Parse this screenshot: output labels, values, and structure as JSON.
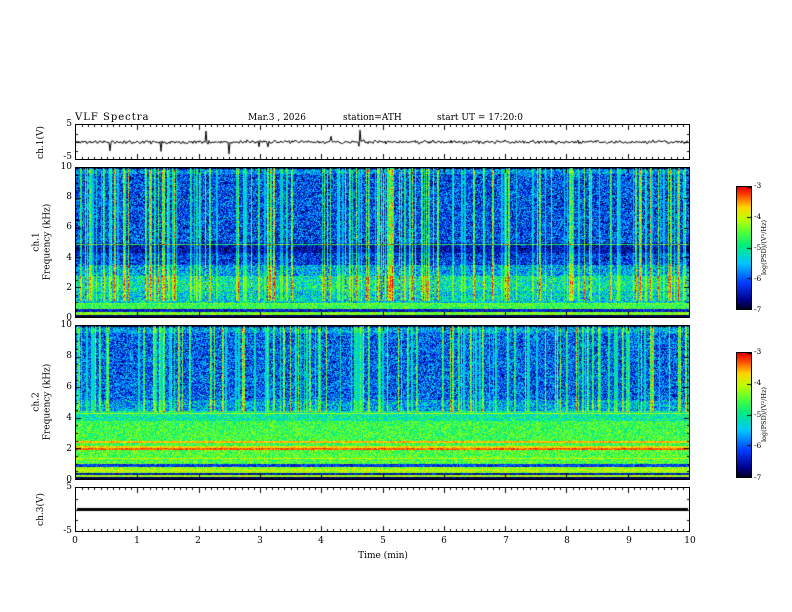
{
  "header": {
    "title": "VLF Spectra",
    "date": "Mar.3 , 2026",
    "station": "station=ATH",
    "start_ut": "start UT =  17:20:0"
  },
  "axes": {
    "time_label": "Time (min)",
    "time_ticks": [
      "0",
      "1",
      "2",
      "3",
      "4",
      "5",
      "6",
      "7",
      "8",
      "9",
      "10"
    ],
    "volt_max": "5",
    "volt_min": "-5",
    "freq_ticks": [
      "10",
      "8",
      "6",
      "4",
      "2",
      "0"
    ],
    "ch1_wave_label": "ch.1(V)",
    "ch1_spec_channel": "ch.1",
    "ch2_spec_channel": "ch.2",
    "freq_axis_label": "Frequency (kHz)",
    "ch3_wave_label": "ch.3(V)"
  },
  "colorbar": {
    "label": "log(PSD)/(V²/Hz)",
    "ticks": [
      "-3",
      "-4",
      "-5",
      "-6",
      "-7"
    ]
  },
  "chart_data": [
    {
      "type": "line",
      "name": "ch.1 waveform",
      "ylabel": "ch.1(V)",
      "xlabel": "Time (min)",
      "xlim": [
        0,
        10
      ],
      "ylim": [
        -5,
        5
      ],
      "seed": 11,
      "noise_v": 0.5,
      "spike_prob": 0.015,
      "spike_amp": 3.2,
      "description": "Noisy signal fluctuating around 0 V with ~0.5 V jitter and occasional impulsive spikes, mostly downward to about -4 V, a few upward to about +2 V."
    },
    {
      "type": "heatmap",
      "name": "ch.1 spectrogram",
      "ylabel": "Frequency (kHz)",
      "xlabel": "Time (min)",
      "colorbar_label": "log(PSD)/(V²/Hz)",
      "xlim": [
        0,
        10
      ],
      "ylim": [
        0,
        10
      ],
      "zlim": [
        -7,
        -3
      ],
      "seed": 42,
      "bands": [
        [
          0.0,
          0.15,
          -6.8,
          0.2
        ],
        [
          0.15,
          0.35,
          -4.3,
          0.4
        ],
        [
          0.35,
          0.55,
          -6.4,
          0.5
        ],
        [
          0.55,
          1.0,
          -4.6,
          0.5
        ],
        [
          1.0,
          1.8,
          -5.3,
          0.8
        ],
        [
          1.8,
          2.8,
          -5.1,
          0.8
        ],
        [
          2.8,
          3.5,
          -5.6,
          0.8
        ],
        [
          3.5,
          4.3,
          -6.2,
          0.7
        ],
        [
          4.3,
          5.0,
          -6.5,
          0.6
        ],
        [
          5.0,
          9.6,
          -6.1,
          0.8
        ],
        [
          9.6,
          10.0,
          -5.7,
          0.7
        ]
      ],
      "lines": [
        [
          4.9,
          0.05,
          -4.8
        ],
        [
          0.95,
          0.05,
          -4.4
        ]
      ],
      "streaks": {
        "prob": 0.28,
        "fmin": 1.1,
        "min_boost": 0.7,
        "max_boost": 2.3
      },
      "description": "Blue/dark background above ~4 kHz crossed by dense vertical sferic streaks (cyan-green-yellow); green/cyan speckle 1-3.5 kHz; bright green bands below 1 kHz separated by dark gaps; dark band 4.3-5 kHz."
    },
    {
      "type": "heatmap",
      "name": "ch.2 spectrogram",
      "ylabel": "Frequency (kHz)",
      "xlabel": "Time (min)",
      "colorbar_label": "log(PSD)/(V²/Hz)",
      "xlim": [
        0,
        10
      ],
      "ylim": [
        0,
        10
      ],
      "zlim": [
        -7,
        -3
      ],
      "seed": 77,
      "bands": [
        [
          0.0,
          0.15,
          -6.8,
          0.2
        ],
        [
          0.15,
          0.3,
          -4.1,
          0.4
        ],
        [
          0.3,
          0.45,
          -6.5,
          0.5
        ],
        [
          0.45,
          0.8,
          -4.2,
          0.4
        ],
        [
          0.8,
          1.0,
          -6.2,
          0.5
        ],
        [
          1.0,
          2.0,
          -4.5,
          0.5
        ],
        [
          2.0,
          2.2,
          -3.8,
          0.4
        ],
        [
          2.2,
          3.8,
          -4.6,
          0.5
        ],
        [
          3.8,
          4.5,
          -5.0,
          0.6
        ],
        [
          4.5,
          5.2,
          -5.6,
          0.8
        ],
        [
          5.2,
          9.6,
          -6.0,
          0.8
        ],
        [
          9.6,
          10.0,
          -5.6,
          0.7
        ]
      ],
      "lines": [
        [
          2.0,
          0.06,
          -3.3
        ],
        [
          2.45,
          0.04,
          -3.6
        ],
        [
          4.3,
          0.05,
          -4.2
        ],
        [
          1.35,
          0.04,
          -4.0
        ],
        [
          0.6,
          0.04,
          -3.9
        ]
      ],
      "streaks": {
        "prob": 0.26,
        "fmin": 4.4,
        "min_boost": 0.7,
        "max_boost": 2.2
      },
      "description": "Bright green/yellow continuum below ~4.5 kHz with orange-red horizontal interference lines near 2 and 2.5 kHz; blue background with vertical sferic streaks above ~5 kHz; striped bright/dark bands below 1 kHz."
    },
    {
      "type": "line",
      "name": "ch.3 waveform",
      "ylabel": "ch.3(V)",
      "xlabel": "Time (min)",
      "xlim": [
        0,
        10
      ],
      "ylim": [
        -5,
        5
      ],
      "flat": true,
      "flat_value": 0,
      "line_width": 3,
      "seed": 5,
      "description": "Constant flat thick line at 0 V (channel inactive)."
    }
  ]
}
